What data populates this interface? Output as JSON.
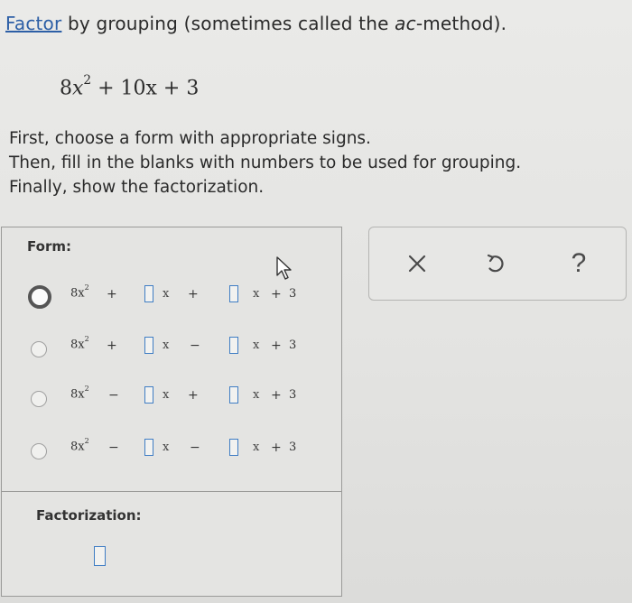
{
  "prompt": {
    "link_word": "Factor",
    "text_before_italic": " by grouping (sometimes called the ",
    "italic": "ac",
    "text_after_italic": "-method)."
  },
  "expression": {
    "coef": "8",
    "var": "x",
    "exp": "2",
    "rest": " + 10x + 3"
  },
  "instructions": [
    "First, choose a form with appropriate signs.",
    "Then, fill in the blanks with numbers to be used for grouping.",
    "Finally, show the factorization."
  ],
  "answer_panel": {
    "form_label": "Form:",
    "factorization_label": "Factorization:",
    "forms": [
      {
        "lead": "8x",
        "exp": "2",
        "op1": "+",
        "op2": "+",
        "op3": "+",
        "tail": "3",
        "selected": true
      },
      {
        "lead": "8x",
        "exp": "2",
        "op1": "+",
        "op2": "−",
        "op3": "+",
        "tail": "3",
        "selected": false
      },
      {
        "lead": "8x",
        "exp": "2",
        "op1": "−",
        "op2": "+",
        "op3": "+",
        "tail": "3",
        "selected": false
      },
      {
        "lead": "8x",
        "exp": "2",
        "op1": "−",
        "op2": "−",
        "op3": "+",
        "tail": "3",
        "selected": false
      }
    ],
    "x_symbol": "x"
  },
  "tools": {
    "clear_icon": "close-icon",
    "undo_icon": "undo-icon",
    "help_label": "?"
  },
  "colors": {
    "link": "#2d5fa6",
    "blank_border": "#3f7dc4",
    "selected_radio": "#555555"
  }
}
